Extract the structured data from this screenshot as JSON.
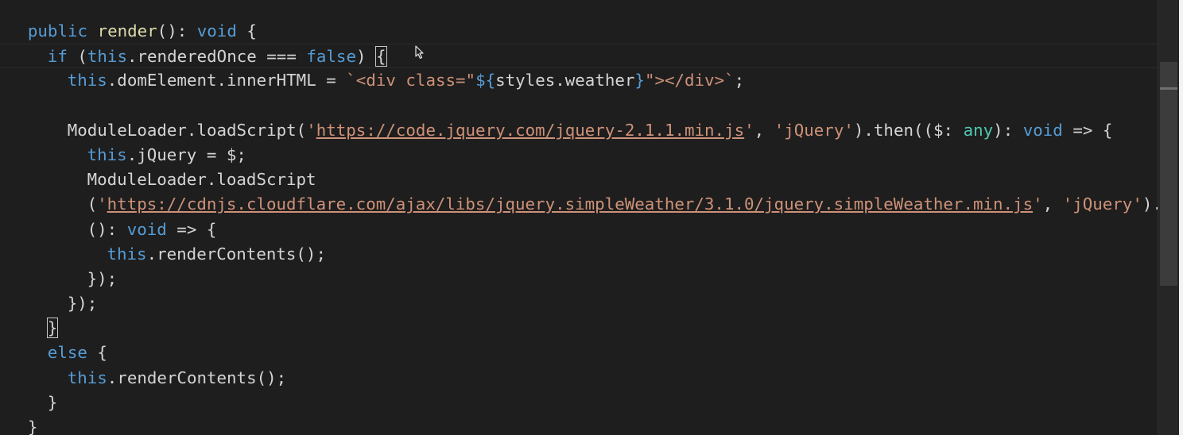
{
  "editor": {
    "language": "TypeScript",
    "lines": [
      {
        "indent": 1,
        "tokens": [
          {
            "t": "public",
            "c": "kw"
          },
          {
            "t": " "
          },
          {
            "t": "render",
            "c": "fn"
          },
          {
            "t": "(): "
          },
          {
            "t": "void",
            "c": "kw"
          },
          {
            "t": " {"
          }
        ]
      },
      {
        "indent": 2,
        "current": true,
        "tokens": [
          {
            "t": "if",
            "c": "ctl"
          },
          {
            "t": " ("
          },
          {
            "t": "this",
            "c": "kw"
          },
          {
            "t": ".renderedOnce === "
          },
          {
            "t": "false",
            "c": "kw"
          },
          {
            "t": ") "
          },
          {
            "t": "{",
            "match": true
          }
        ]
      },
      {
        "indent": 3,
        "tokens": [
          {
            "t": "this",
            "c": "kw"
          },
          {
            "t": ".domElement.innerHTML = "
          },
          {
            "t": "`<div class=\"",
            "c": "str"
          },
          {
            "t": "${",
            "c": "kw"
          },
          {
            "t": "styles.weather"
          },
          {
            "t": "}",
            "c": "kw"
          },
          {
            "t": "\"></div>`",
            "c": "str"
          },
          {
            "t": ";"
          }
        ]
      },
      {
        "indent": 0,
        "tokens": []
      },
      {
        "indent": 3,
        "tokens": [
          {
            "t": "ModuleLoader.loadScript("
          },
          {
            "t": "'",
            "c": "str"
          },
          {
            "t": "https://code.jquery.com/jquery-2.1.1.min.js",
            "c": "link"
          },
          {
            "t": "'",
            "c": "str"
          },
          {
            "t": ", "
          },
          {
            "t": "'jQuery'",
            "c": "str"
          },
          {
            "t": ").then(($: "
          },
          {
            "t": "any",
            "c": "type"
          },
          {
            "t": "): "
          },
          {
            "t": "void",
            "c": "kw"
          },
          {
            "t": " => {"
          }
        ]
      },
      {
        "indent": 4,
        "tokens": [
          {
            "t": "this",
            "c": "kw"
          },
          {
            "t": ".jQuery = $;"
          }
        ]
      },
      {
        "indent": 4,
        "tokens": [
          {
            "t": "ModuleLoader.loadScript"
          }
        ]
      },
      {
        "indent": 4,
        "tokens": [
          {
            "t": "("
          },
          {
            "t": "'",
            "c": "str"
          },
          {
            "t": "https://cdnjs.cloudflare.com/ajax/libs/jquery.simpleWeather/3.1.0/jquery.simpleWeather.min.js",
            "c": "link"
          },
          {
            "t": "'",
            "c": "str"
          },
          {
            "t": ", "
          },
          {
            "t": "'jQuery'",
            "c": "str"
          },
          {
            "t": ").th"
          }
        ]
      },
      {
        "indent": 4,
        "tokens": [
          {
            "t": "(): "
          },
          {
            "t": "void",
            "c": "kw"
          },
          {
            "t": " => {"
          }
        ]
      },
      {
        "indent": 5,
        "tokens": [
          {
            "t": "this",
            "c": "kw"
          },
          {
            "t": ".renderContents();"
          }
        ]
      },
      {
        "indent": 4,
        "tokens": [
          {
            "t": "});"
          }
        ]
      },
      {
        "indent": 3,
        "tokens": [
          {
            "t": "});"
          }
        ]
      },
      {
        "indent": 2,
        "tokens": [
          {
            "t": "}",
            "match": true
          }
        ]
      },
      {
        "indent": 2,
        "tokens": [
          {
            "t": "else",
            "c": "ctl"
          },
          {
            "t": " {"
          }
        ]
      },
      {
        "indent": 3,
        "tokens": [
          {
            "t": "this",
            "c": "kw"
          },
          {
            "t": ".renderContents();"
          }
        ]
      },
      {
        "indent": 2,
        "tokens": [
          {
            "t": "}"
          }
        ]
      },
      {
        "indent": 1,
        "tokens": [
          {
            "t": "}"
          }
        ]
      }
    ]
  },
  "colors": {
    "background": "#1e1e1e",
    "keyword": "#569cd6",
    "function": "#dcdcaa",
    "string": "#ce9178",
    "type": "#4ec9b0",
    "text": "#d4d4d4"
  },
  "icons": {
    "cursor": "mouse-pointer-icon"
  }
}
